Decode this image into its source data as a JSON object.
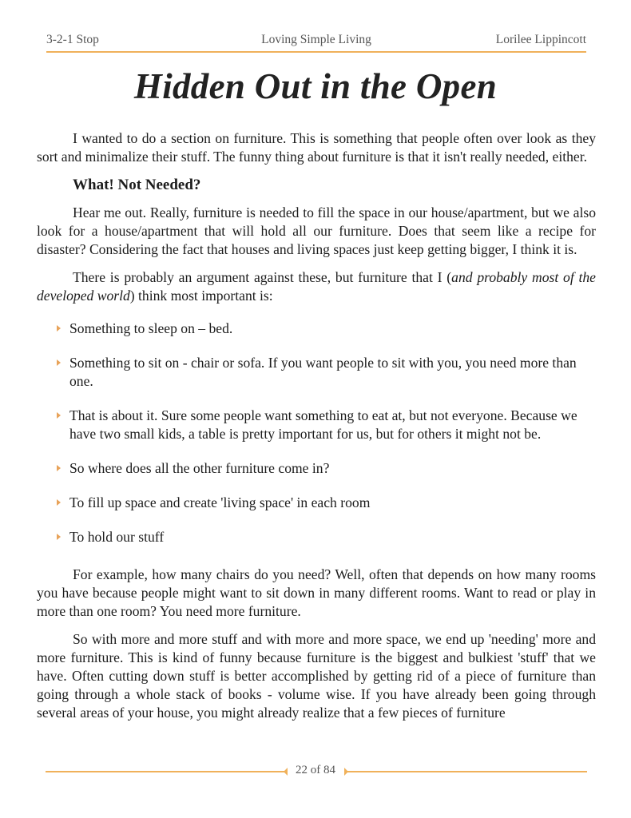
{
  "header": {
    "left": "3-2-1 Stop",
    "center": "Loving Simple Living",
    "right": "Lorilee Lippincott"
  },
  "title": "Hidden Out in the Open",
  "intro": "I wanted to do a section on furniture. This is something that people often over look as they sort and minimalize their stuff. The funny thing about furniture is that it isn't really needed, either.",
  "subheading": "What! Not Needed?",
  "paragraph_2": "Hear me out. Really, furniture is needed to fill the space in our house/apartment, but we also look for a house/apartment that will hold all our furniture. Does that seem like a recipe for disaster? Considering the fact that houses and living spaces just keep getting bigger, I think it is.",
  "paragraph_3": {
    "before": "There is probably an argument against these, but furniture that I (",
    "italic": "and probably most of the developed world",
    "after": ") think most important is:"
  },
  "bullets": [
    "Something to sleep on – bed.",
    "Something to sit on - chair or sofa. If you want people to sit with you, you need more than one.",
    " That is about it. Sure some people want something to eat at, but not everyone. Because we have two small kids, a table is pretty important for us, but for others it might not be.",
    " So where does all the other furniture come in?",
    "To fill up space and create 'living space' in each room",
    "To hold our stuff"
  ],
  "paragraph_4": "For example, how many chairs do you need? Well, often that depends on how many rooms you have because people might want to sit down in many different rooms. Want to read or play in more than one room? You need more furniture.",
  "paragraph_5": "So with more and more stuff and with more and more space, we end up 'needing' more and more furniture. This is kind of funny because furniture is the biggest and bulkiest 'stuff' that we have. Often cutting down stuff is better accomplished by getting rid of a piece of furniture than going through a whole stack of books - volume wise. If you have already been going through several areas of your house, you might already realize that a few pieces of furniture",
  "footer": {
    "page_label": "22 of 84",
    "current_page": 22,
    "total_pages": 84
  },
  "colors": {
    "accent": "#f0b15a",
    "bullet": "#e8a35a",
    "text": "#1c1c1c",
    "header_text": "#555555"
  }
}
